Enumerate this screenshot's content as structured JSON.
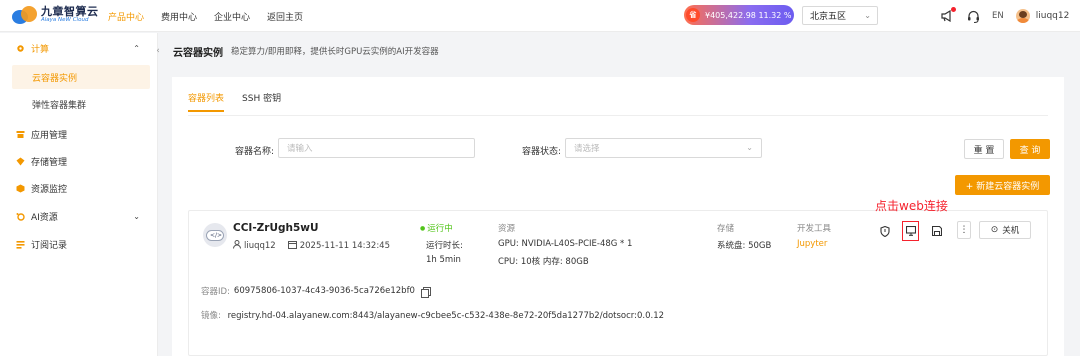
{
  "brand": {
    "name_cn": "九章智算云",
    "name_en": "Alaya NeW Cloud"
  },
  "topnav": {
    "items": [
      {
        "label": "产品中心",
        "active": true
      },
      {
        "label": "费用中心",
        "active": false
      },
      {
        "label": "企业中心",
        "active": false
      },
      {
        "label": "返回主页",
        "active": false
      }
    ]
  },
  "balance": {
    "coin": "省",
    "amount": "¥405,422.98  11.32 %"
  },
  "region": {
    "selected": "北京五区"
  },
  "header_right": {
    "lang": "EN",
    "username": "liuqq12"
  },
  "sidebar": {
    "items": [
      {
        "label": "计算",
        "group": true,
        "expanded": true
      },
      {
        "label": "云容器实例",
        "sub": true,
        "active": true
      },
      {
        "label": "弹性容器集群",
        "sub": true,
        "active": false
      },
      {
        "label": "应用管理"
      },
      {
        "label": "存储管理"
      },
      {
        "label": "资源监控"
      },
      {
        "label": "AI资源",
        "has_caret": true
      },
      {
        "label": "订阅记录"
      }
    ]
  },
  "page": {
    "title": "云容器实例",
    "description": "稳定算力/即用即释，提供长时GPU云实例的AI开发容器"
  },
  "tabs": [
    {
      "label": "容器列表",
      "active": true
    },
    {
      "label": "SSH 密钥",
      "active": false
    }
  ],
  "filters": {
    "name_label": "容器名称:",
    "name_placeholder": "请输入",
    "status_label": "容器状态:",
    "status_placeholder": "请选择",
    "reset_label": "重 置",
    "search_label": "查 询",
    "create_label": "+ 新建云容器实例"
  },
  "annotation": "点击web连接",
  "instance": {
    "name": "CCI-ZrUgh5wU",
    "owner": "liuqq12",
    "created": "2025-11-11 14:32:45",
    "status": "运行中",
    "runtime_label": "运行时长:",
    "runtime_value": "1h 5min",
    "resource_title": "资源",
    "gpu": "GPU:  NVIDIA-L40S-PCIE-48G  * 1",
    "cpu": "CPU:  10核  内存:  80GB",
    "storage_title": "存储",
    "storage_value": "系统盘:  50GB",
    "tools_title": "开发工具",
    "tools_value": "Jupyter",
    "power_label": "关机",
    "id_label": "容器ID:",
    "id_value": "60975806-1037-4c43-9036-5ca726e12bf0",
    "image_label": "镜像:",
    "image_value": "registry.hd-04.alayanew.com:8443/alayanew-c9cbee5c-c532-438e-8e72-20f5da1277b2/dotsocr:0.0.12"
  },
  "colors": {
    "accent": "#f39800",
    "running": "#52c41a",
    "annotation": "#f5222d"
  }
}
